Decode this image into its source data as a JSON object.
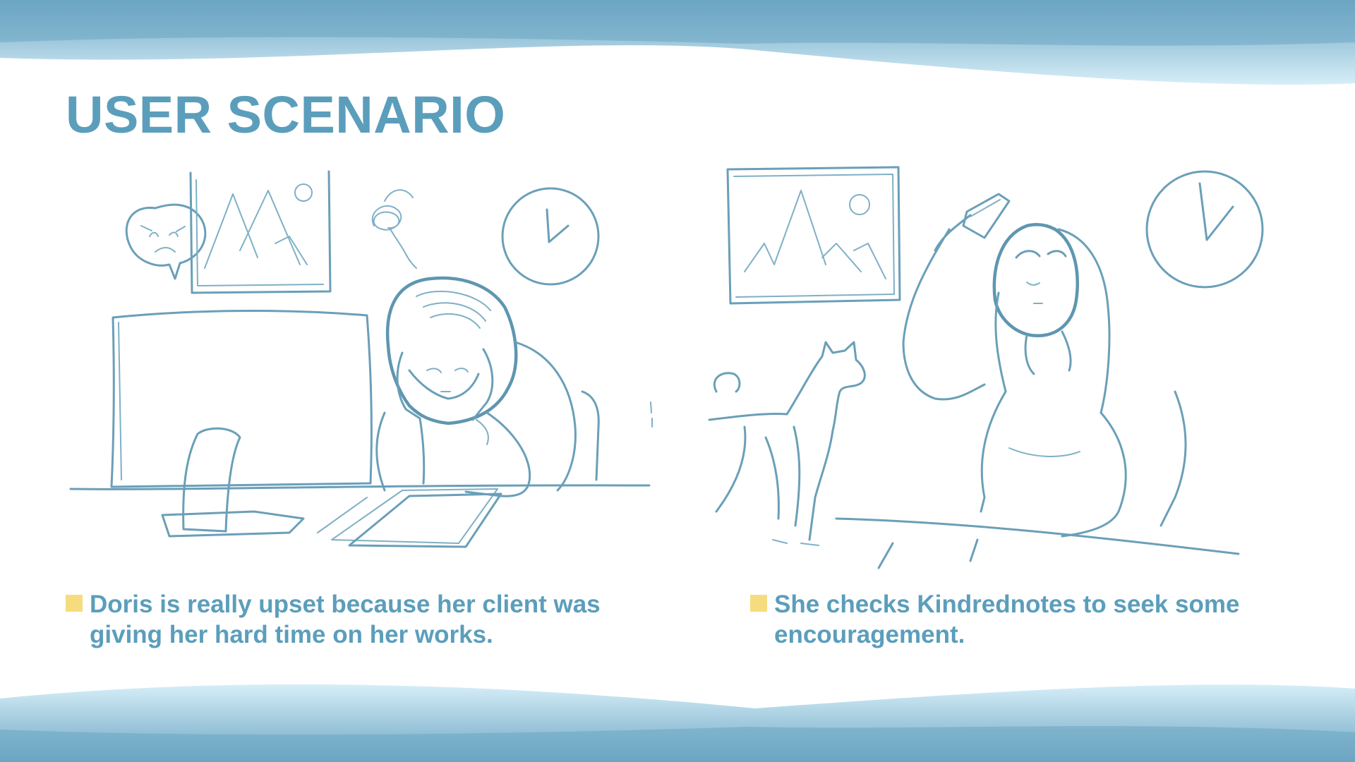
{
  "slide": {
    "title": "USER SCENARIO",
    "colors": {
      "title": "#5b9ebb",
      "bullet": "#f5dc7e",
      "wave_light": "#d6eef8",
      "wave_dark": "#6ba5c2",
      "sketch_stroke": "#6a9fb8"
    },
    "scenes": [
      {
        "caption": "Doris is really upset because her client was giving her hard time on her works."
      },
      {
        "caption": "She checks Kindrednotes to seek some encouragement."
      }
    ]
  }
}
